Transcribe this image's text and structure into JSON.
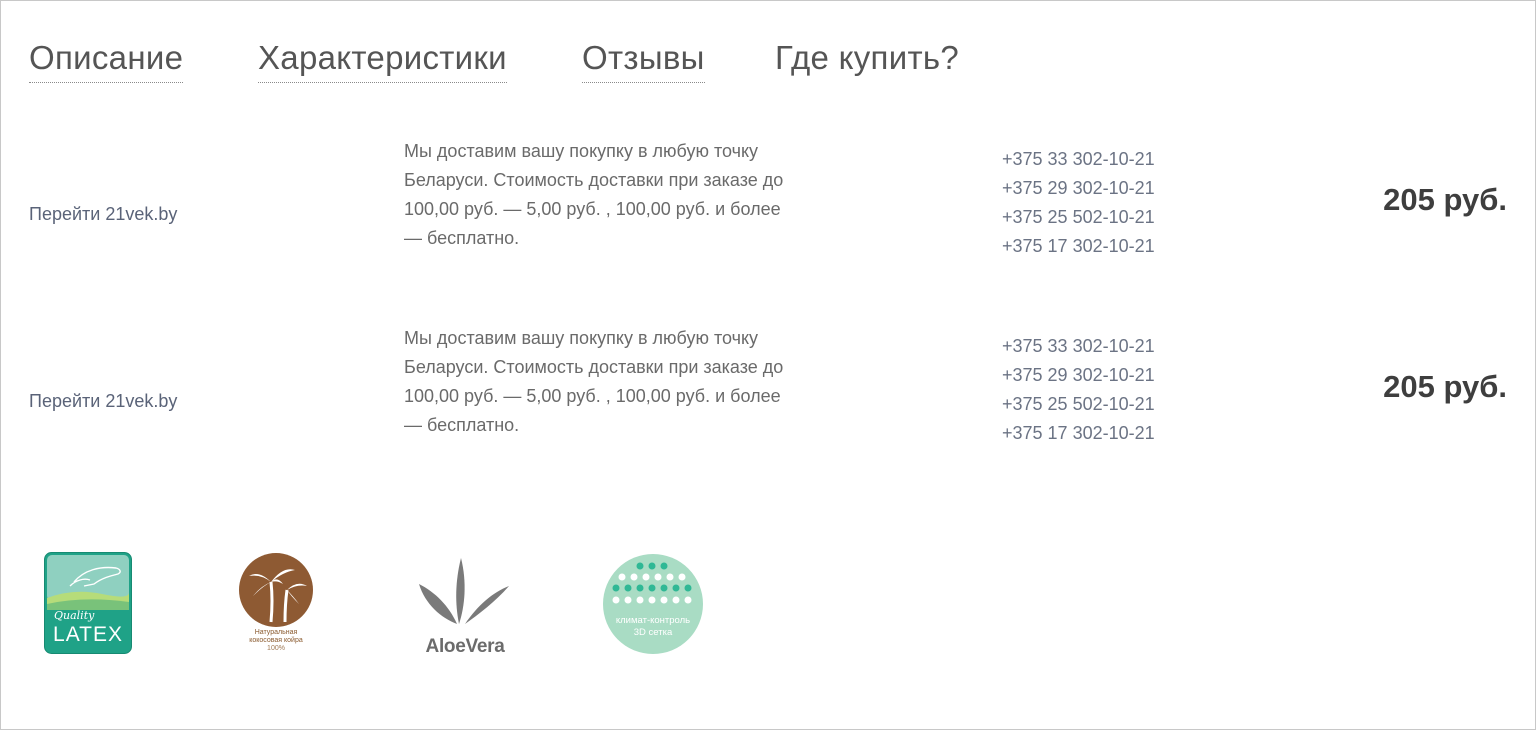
{
  "tabs": [
    {
      "label": "Описание"
    },
    {
      "label": "Характеристики"
    },
    {
      "label": "Отзывы"
    },
    {
      "label": "Где купить?"
    }
  ],
  "offers": [
    {
      "store_link": "Перейти 21vek.by",
      "delivery": "Мы доставим вашу покупку в любую точку Беларуси. Стоимость доставки при заказе до 100,00 руб. — 5,00 руб. , 100,00 руб. и более — бесплатно.",
      "phones": [
        "+375 33 302-10-21",
        "+375 29 302-10-21",
        "+375 25 502-10-21",
        "+375 17 302-10-21"
      ],
      "price": "205 руб."
    },
    {
      "store_link": "Перейти 21vek.by",
      "delivery": "Мы доставим вашу покупку в любую точку Беларуси. Стоимость доставки при заказе до 100,00 руб. — 5,00 руб. , 100,00 руб. и более — бесплатно.",
      "phones": [
        "+375 33 302-10-21",
        "+375 29 302-10-21",
        "+375 25 502-10-21",
        "+375 17 302-10-21"
      ],
      "price": "205 руб."
    }
  ],
  "badges": {
    "latex": {
      "icon": "quality-latex-icon",
      "quality": "Quality",
      "label": "LATEX"
    },
    "coir": {
      "icon": "coconut-coir-icon",
      "line1": "Натуральная",
      "line2": "кокосовая койра",
      "line3": "100%"
    },
    "aloe": {
      "icon": "aloe-vera-icon",
      "label": "AloeVera"
    },
    "climate": {
      "icon": "climate-control-3d-icon",
      "line1": "климат-контроль",
      "line2": "3D сетка"
    }
  },
  "colors": {
    "latex_green": "#1fa287",
    "latex_light": "#8fd0c0",
    "coir_brown": "#8e5a33",
    "aloe_gray": "#7a7a7a",
    "climate_mint": "#a9dcc4",
    "climate_teal": "#2fb895"
  }
}
